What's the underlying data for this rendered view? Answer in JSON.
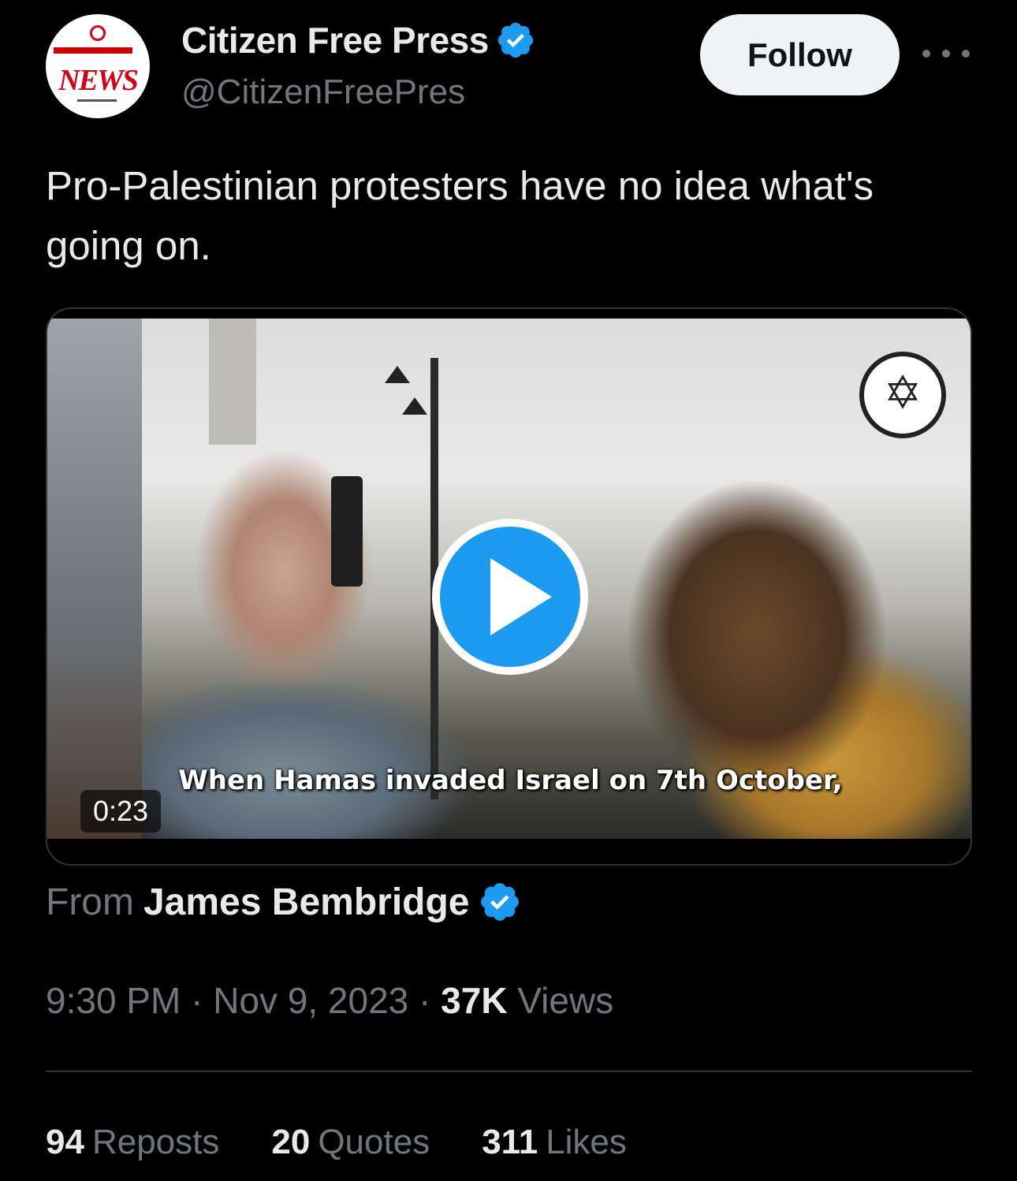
{
  "header": {
    "display_name": "Citizen Free Press",
    "handle": "@CitizenFreePres",
    "avatar_text": "NEWS",
    "follow_label": "Follow"
  },
  "tweet": {
    "text": "Pro-Palestinian protesters have no idea what's going on."
  },
  "media": {
    "subtitle": "When Hamas invaded Israel on 7th October,",
    "duration": "0:23"
  },
  "attribution": {
    "from_label": "From",
    "from_name": "James Bembridge"
  },
  "meta": {
    "time": "9:30 PM",
    "date": "Nov 9, 2023",
    "views_count": "37K",
    "views_label": "Views"
  },
  "stats": [
    {
      "count": "94",
      "label": "Reposts"
    },
    {
      "count": "20",
      "label": "Quotes"
    },
    {
      "count": "311",
      "label": "Likes"
    }
  ],
  "colors": {
    "background": "#000000",
    "verified": "#1d9bf0",
    "muted": "#71767b",
    "text": "#e7e9ea"
  }
}
